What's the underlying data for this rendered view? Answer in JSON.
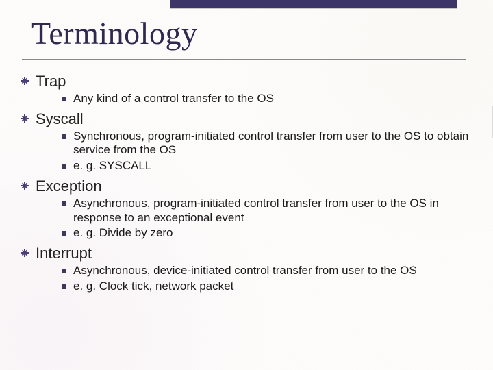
{
  "title": "Terminology",
  "items": [
    {
      "label": "Trap",
      "subs": [
        {
          "text": "Any kind of a control transfer to the OS"
        }
      ]
    },
    {
      "label": "Syscall",
      "subs": [
        {
          "text": "Synchronous, program-initiated control transfer from user to the OS to obtain service from the OS"
        },
        {
          "text": "e. g. SYSCALL"
        }
      ]
    },
    {
      "label": "Exception",
      "subs": [
        {
          "text": "Asynchronous, program-initiated control transfer from user to the OS in response to an exceptional event"
        },
        {
          "text": "e. g. Divide by zero"
        }
      ]
    },
    {
      "label": "Interrupt",
      "subs": [
        {
          "text": "Asynchronous, device-initiated control transfer from user to the OS"
        },
        {
          "text": "e. g. Clock tick, network packet"
        }
      ]
    }
  ]
}
